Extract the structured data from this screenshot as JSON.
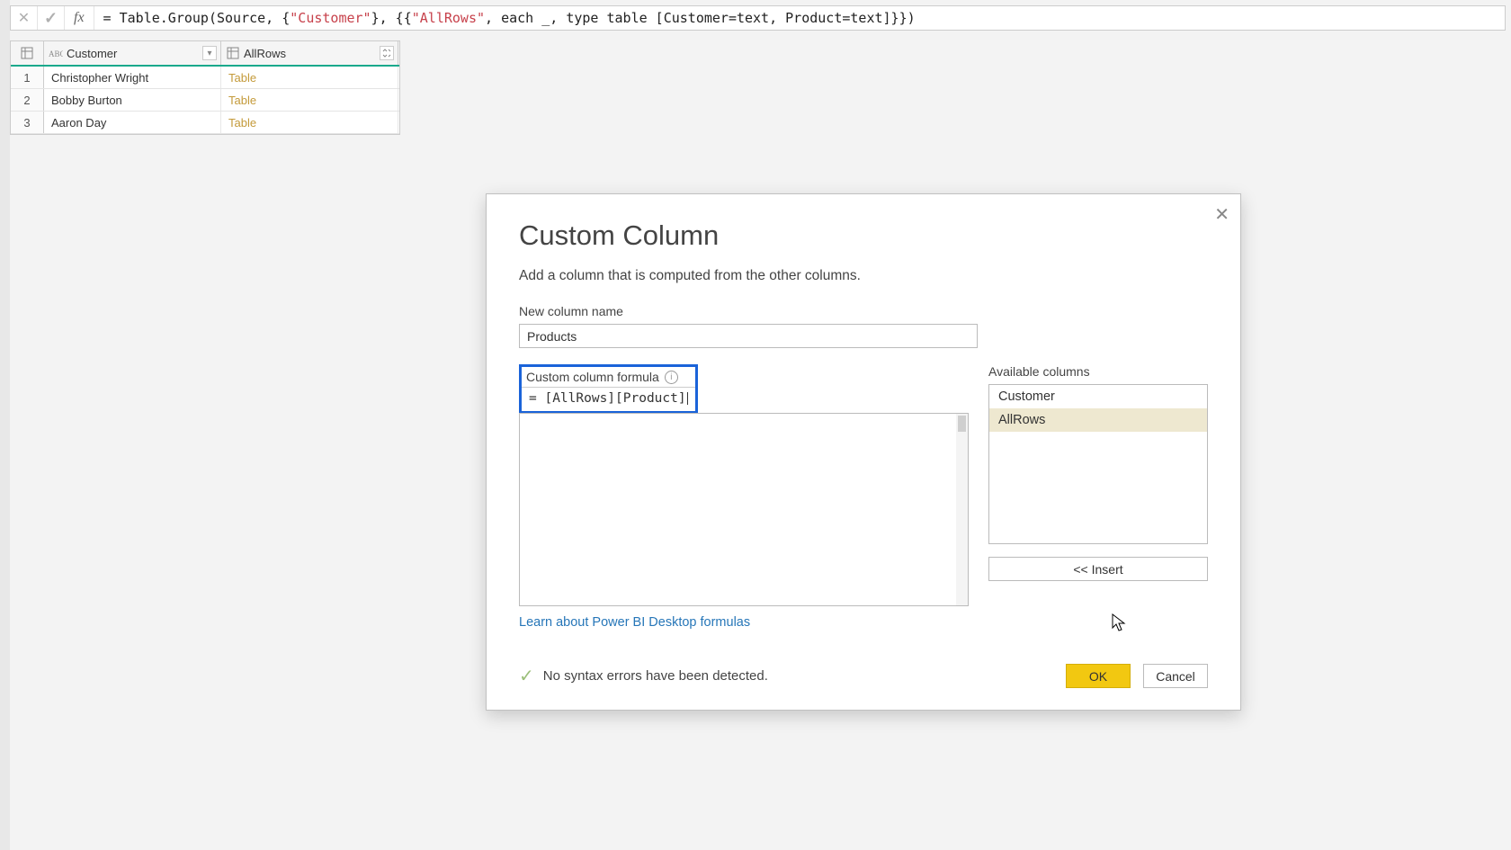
{
  "formulabar": {
    "formula_prefix": "= Table.Group(Source, {",
    "formula_str1": "\"Customer\"",
    "formula_mid": "}, {{",
    "formula_str2": "\"AllRows\"",
    "formula_suffix": ", each _, type table [Customer=text, Product=text]}})"
  },
  "table": {
    "columns": [
      {
        "name": "Customer"
      },
      {
        "name": "AllRows"
      }
    ],
    "rows": [
      {
        "idx": "1",
        "customer": "Christopher Wright",
        "allrows": "Table"
      },
      {
        "idx": "2",
        "customer": "Bobby Burton",
        "allrows": "Table"
      },
      {
        "idx": "3",
        "customer": "Aaron Day",
        "allrows": "Table"
      }
    ]
  },
  "dialog": {
    "title": "Custom Column",
    "subtitle": "Add a column that is computed from the other columns.",
    "name_label": "New column name",
    "name_value": "Products",
    "formula_label": "Custom column formula",
    "formula_value": "= [AllRows][Product]",
    "available_label": "Available columns",
    "available_items": [
      {
        "label": "Customer"
      },
      {
        "label": "AllRows"
      }
    ],
    "insert_label": "<< Insert",
    "learn_label": "Learn about Power BI Desktop formulas",
    "status_text": "No syntax errors have been detected.",
    "ok_label": "OK",
    "cancel_label": "Cancel"
  }
}
